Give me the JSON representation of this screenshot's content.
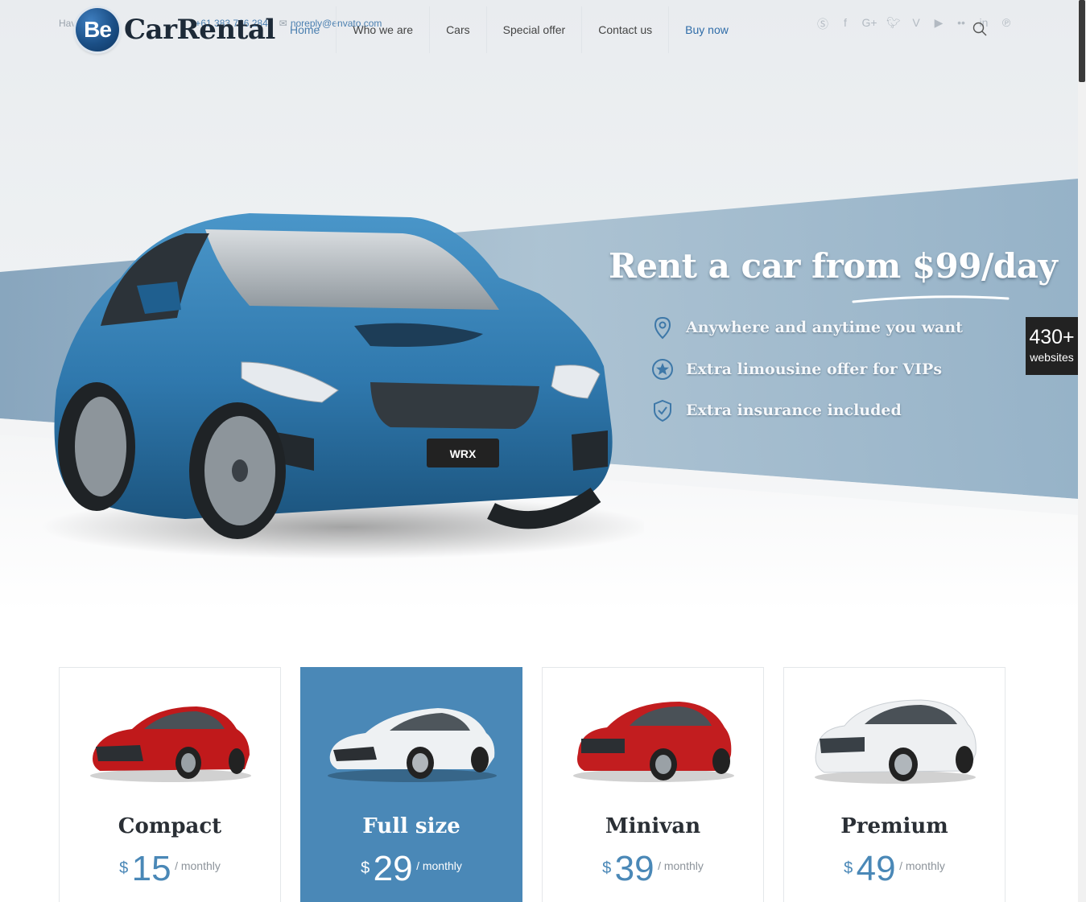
{
  "topbar": {
    "prefix": "Hav",
    "phone": "+61 383 766 284",
    "email": "noreply@envato.com"
  },
  "logo": {
    "badge": "Be",
    "name": "CarRental"
  },
  "nav": [
    "Home",
    "Who we are",
    "Cars",
    "Special offer",
    "Contact us",
    "Buy now"
  ],
  "social": [
    "skype-icon",
    "facebook-icon",
    "google-plus-icon",
    "twitter-icon",
    "vimeo-icon",
    "youtube-icon",
    "flickr-icon",
    "linkedin-icon",
    "pinterest-icon"
  ],
  "hero": {
    "title": "Rent a car from $99/day",
    "features": [
      "Anywhere and anytime you want",
      "Extra limousine offer for VIPs",
      "Extra insurance included"
    ],
    "car_plate": "WRX"
  },
  "badge": {
    "count": "430+",
    "label": "websites"
  },
  "colors": {
    "accent": "#4a88b7",
    "brand_dark": "#1b4f86",
    "hero_band": "#9ab7cd"
  },
  "cards": [
    {
      "name": "Compact",
      "currency": "$",
      "price": "15",
      "period": "/ monthly",
      "car_color": "#c0191b"
    },
    {
      "name": "Full size",
      "currency": "$",
      "price": "29",
      "period": "/ monthly",
      "car_color": "#e9ecef"
    },
    {
      "name": "Minivan",
      "currency": "$",
      "price": "39",
      "period": "/ monthly",
      "car_color": "#c21d1f"
    },
    {
      "name": "Premium",
      "currency": "$",
      "price": "49",
      "period": "/ monthly",
      "car_color": "#eef0f2"
    }
  ]
}
